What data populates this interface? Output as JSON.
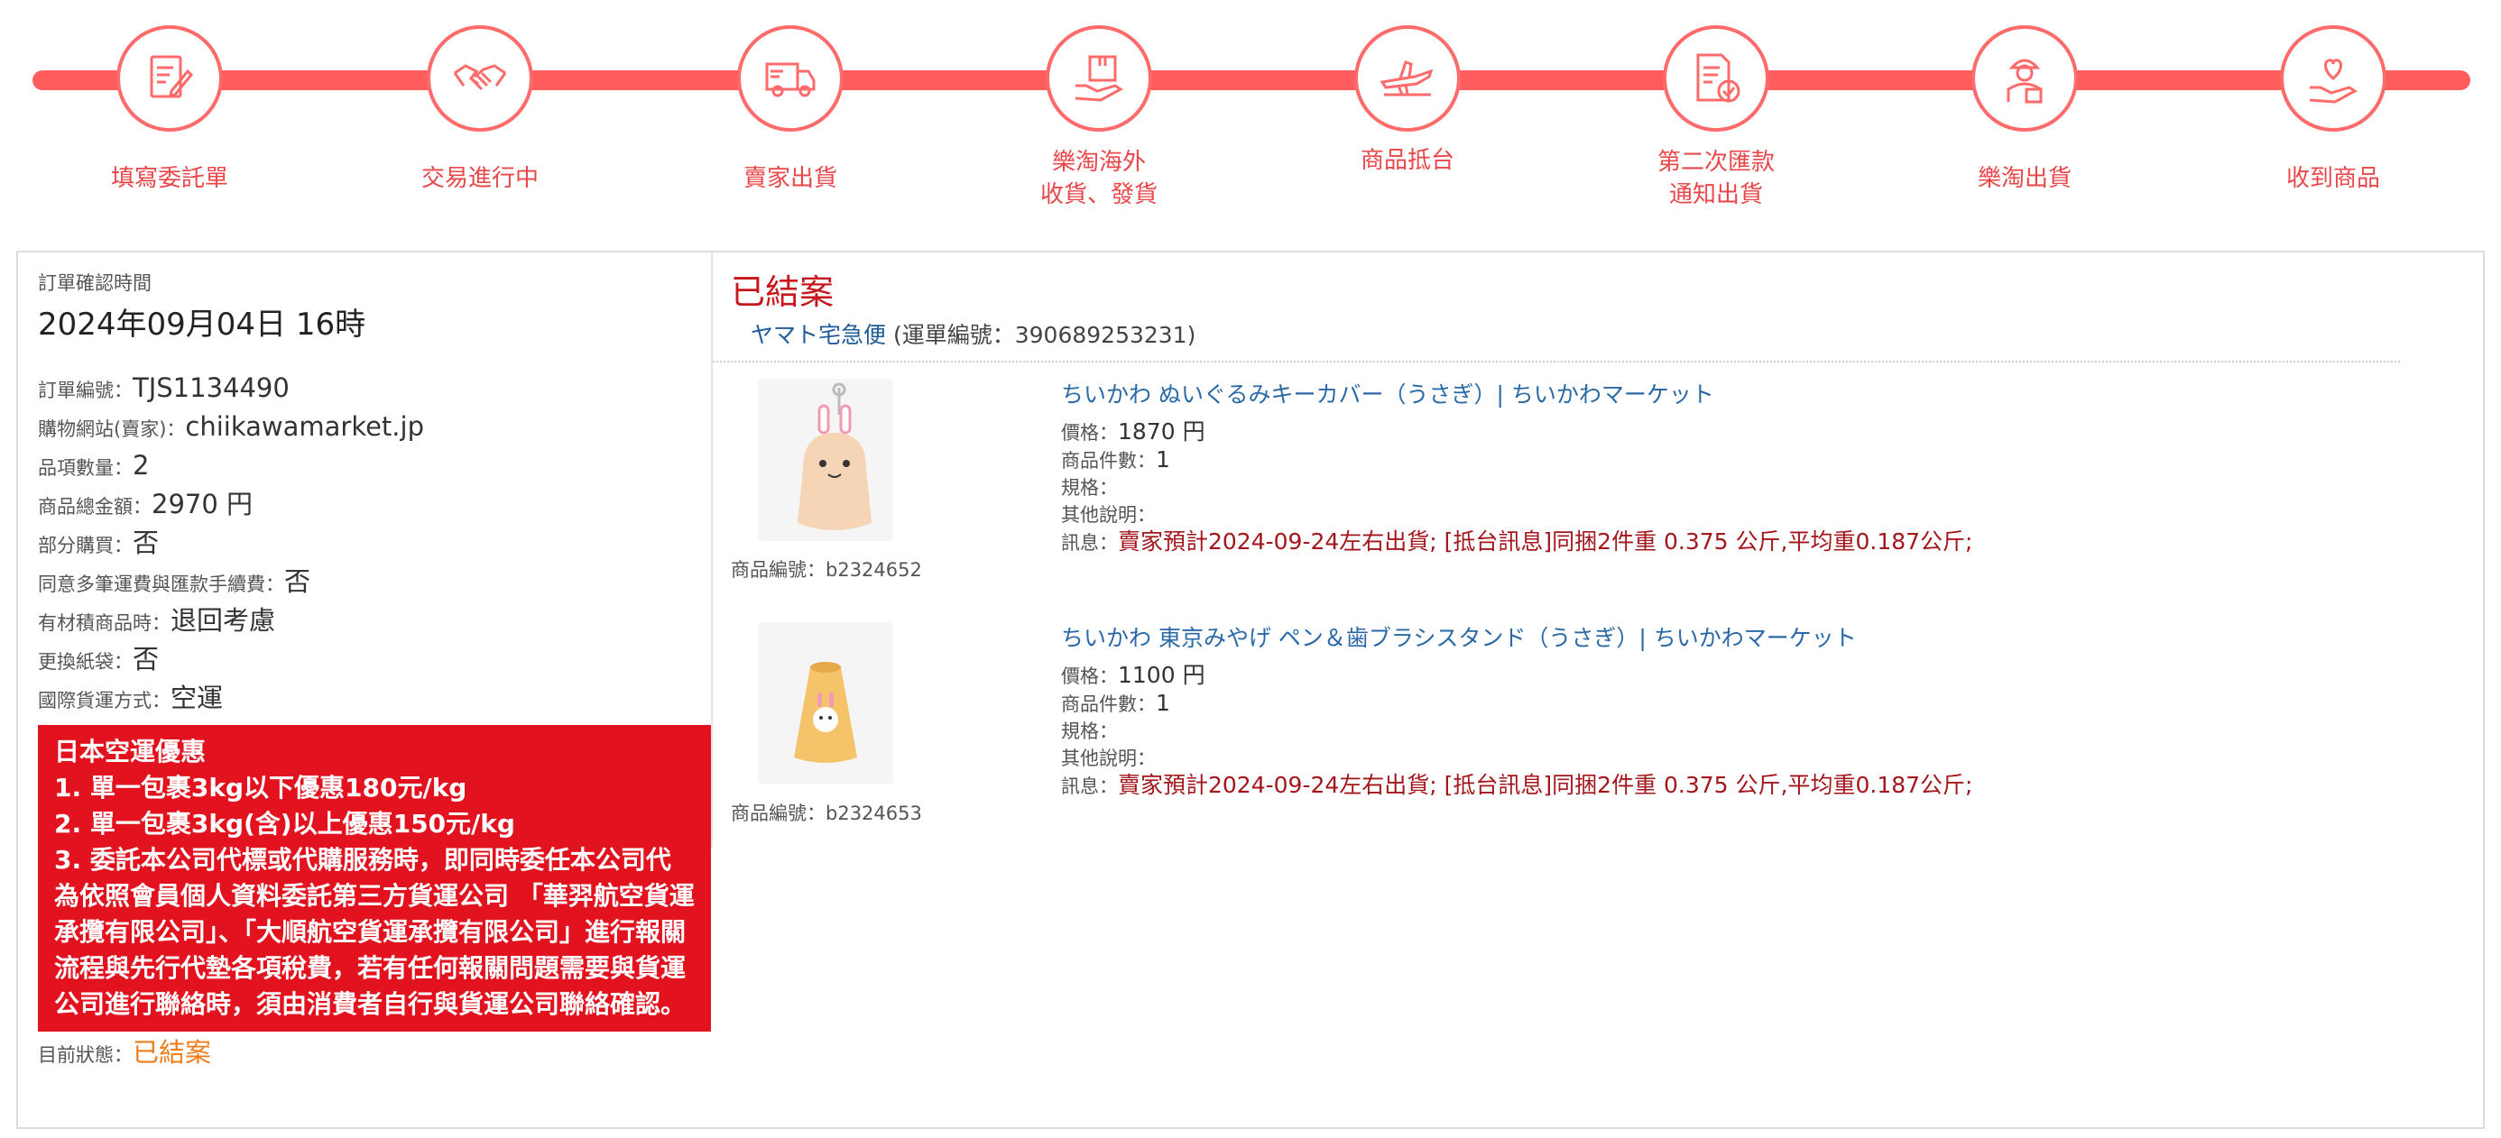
{
  "steps": [
    {
      "label": "填寫委託單",
      "icon": "form-edit-icon"
    },
    {
      "label": "交易進行中",
      "icon": "handshake-icon"
    },
    {
      "label": "賣家出貨",
      "icon": "truck-icon"
    },
    {
      "label": "樂淘海外\n收貨、發貨",
      "icon": "package-hand-icon"
    },
    {
      "label": "商品抵台",
      "icon": "airplane-icon"
    },
    {
      "label": "第二次匯款\n通知出貨",
      "icon": "document-check-icon"
    },
    {
      "label": "樂淘出貨",
      "icon": "courier-icon"
    },
    {
      "label": "收到商品",
      "icon": "heart-hand-icon"
    }
  ],
  "order": {
    "confirm_time_label": "訂單確認時間",
    "confirm_time_value": "2024年09月04日 16時",
    "fields": [
      {
        "label": "訂單編號：",
        "value": "TJS1134490"
      },
      {
        "label": "購物網站(賣家)：",
        "value": "chiikawamarket.jp"
      },
      {
        "label": "品項數量：",
        "value": "2"
      },
      {
        "label": "商品總金額：",
        "value": "2970 円"
      },
      {
        "label": "部分購買：",
        "value": "否"
      },
      {
        "label": "同意多筆運費與匯款手續費：",
        "value": "否"
      },
      {
        "label": "有材積商品時：",
        "value": "退回考慮"
      },
      {
        "label": "更換紙袋：",
        "value": "否"
      },
      {
        "label": "國際貨運方式：",
        "value": "空運"
      }
    ],
    "notice_lines": [
      "日本空運優惠",
      "1. 單一包裹3kg以下優惠180元/kg",
      "2. 單一包裹3kg(含)以上優惠150元/kg",
      "3. 委託本公司代標或代購服務時，即同時委任本公司代為依照會員個人資料委託第三方貨運公司 「華羿航空貨運承攬有限公司」、「大順航空貨運承攬有限公司」進行報關流程與先行代墊各項稅費，若有任何報關問題需要與貨運公司進行聯絡時，須由消費者自行與貨運公司聯絡確認。"
    ],
    "status_label": "目前狀態：",
    "status_value": "已結案"
  },
  "result": {
    "title": "已結案",
    "carrier": "ヤマト宅急便",
    "tracking_text": "(運單編號：390689253231)"
  },
  "items": [
    {
      "name": "ちいかわ ぬいぐるみキーカバー（うさぎ）| ちいかわマーケット",
      "product_id": "商品編號：b2324652",
      "price_label": "價格：",
      "price": "1870 円",
      "qty_label": "商品件數：",
      "qty": "1",
      "spec_label": "規格：",
      "other_label": "其他說明：",
      "msg_label": "訊息：",
      "msg": "賣家預計2024-09-24左右出貨;  [抵台訊息]同捆2件重 0.375 公斤,平均重0.187公斤;"
    },
    {
      "name": "ちいかわ 東京みやげ ペン＆歯ブラシスタンド（うさぎ）| ちいかわマーケット",
      "product_id": "商品編號：b2324653",
      "price_label": "價格：",
      "price": "1100 円",
      "qty_label": "商品件數：",
      "qty": "1",
      "spec_label": "規格：",
      "other_label": "其他說明：",
      "msg_label": "訊息：",
      "msg": "賣家預計2024-09-24左右出貨;  [抵台訊息]同捆2件重 0.375 公斤,平均重0.187公斤;"
    }
  ],
  "colors": {
    "accent": "#ff5d5d",
    "notice_bg": "#e2131e",
    "status": "#ee7d1c",
    "link": "#2a69a6"
  }
}
